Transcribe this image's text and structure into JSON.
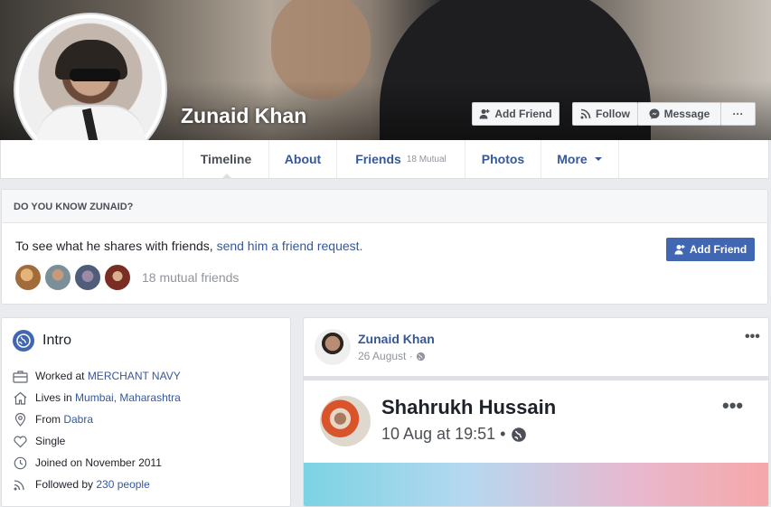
{
  "profile": {
    "name": "Zunaid Khan",
    "buttons": {
      "add_friend": "Add Friend",
      "follow": "Follow",
      "message": "Message",
      "more": "···"
    }
  },
  "nav": {
    "tabs": [
      {
        "label": "Timeline"
      },
      {
        "label": "About"
      },
      {
        "label": "Friends",
        "count": "18 Mutual"
      },
      {
        "label": "Photos"
      },
      {
        "label": "More"
      }
    ]
  },
  "know": {
    "heading": "DO YOU KNOW ZUNAID?",
    "text": "To see what he shares with friends, ",
    "link": "send him a friend request.",
    "add_friend": "Add Friend",
    "mutual_count": "18 mutual friends"
  },
  "intro": {
    "title": "Intro",
    "rows": [
      {
        "icon": "briefcase-icon",
        "prefix": "Worked at ",
        "link": "MERCHANT NAVY",
        "suffix": ""
      },
      {
        "icon": "home-icon",
        "prefix": "Lives in ",
        "link": "Mumbai, Maharashtra",
        "suffix": ""
      },
      {
        "icon": "location-pin-icon",
        "prefix": "From ",
        "link": "Dabra",
        "suffix": ""
      },
      {
        "icon": "heart-icon",
        "prefix": "Single",
        "link": "",
        "suffix": ""
      },
      {
        "icon": "clock-icon",
        "prefix": "Joined on November 2011",
        "link": "",
        "suffix": ""
      },
      {
        "icon": "rss-icon",
        "prefix": "Followed by ",
        "link": "230 people",
        "suffix": ""
      }
    ]
  },
  "post": {
    "author": "Zunaid Khan",
    "date": "26 August ·",
    "menu": "•••",
    "shared": {
      "author": "Shahrukh Hussain",
      "date": "10 Aug at 19:51 •",
      "menu": "•••"
    }
  },
  "colors": {
    "brand_blue": "#4267b2",
    "link_blue": "#365899",
    "background": "#e9ebee"
  }
}
